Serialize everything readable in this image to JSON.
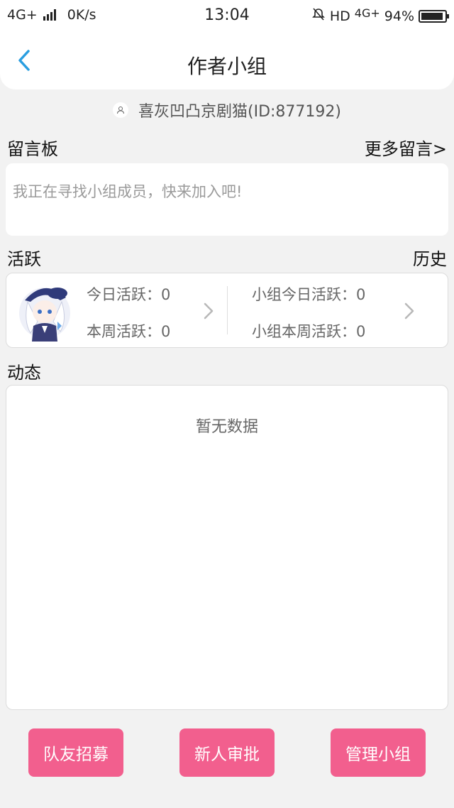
{
  "status_bar": {
    "network": "4G+",
    "speed": "0K/s",
    "time": "13:04",
    "hd_label": "HD",
    "network_right": "4G+",
    "battery": "94%",
    "battery_level": 0.94,
    "icons": [
      "signal-icon",
      "mute-bell-icon",
      "battery-icon"
    ]
  },
  "header": {
    "title": "作者小组",
    "back_icon": "chevron-left-icon",
    "accent_color": "#2a9ee0"
  },
  "owner": {
    "text": "喜灰凹凸京剧猫(ID:877192)"
  },
  "message_board": {
    "label": "留言板",
    "more_link": "更多留言>",
    "message": "我正在寻找小组成员，快来加入吧!"
  },
  "activity": {
    "label": "活跃",
    "history_link": "历史",
    "personal": {
      "today": "今日活跃：0",
      "week": "本周活跃：0"
    },
    "group": {
      "today": "小组今日活跃：0",
      "week": "小组本周活跃：0"
    }
  },
  "feed": {
    "label": "动态",
    "empty_text": "暂无数据"
  },
  "actions": {
    "recruit": "队友招募",
    "approve": "新人审批",
    "manage": "管理小组",
    "button_color": "#f25f8e"
  }
}
